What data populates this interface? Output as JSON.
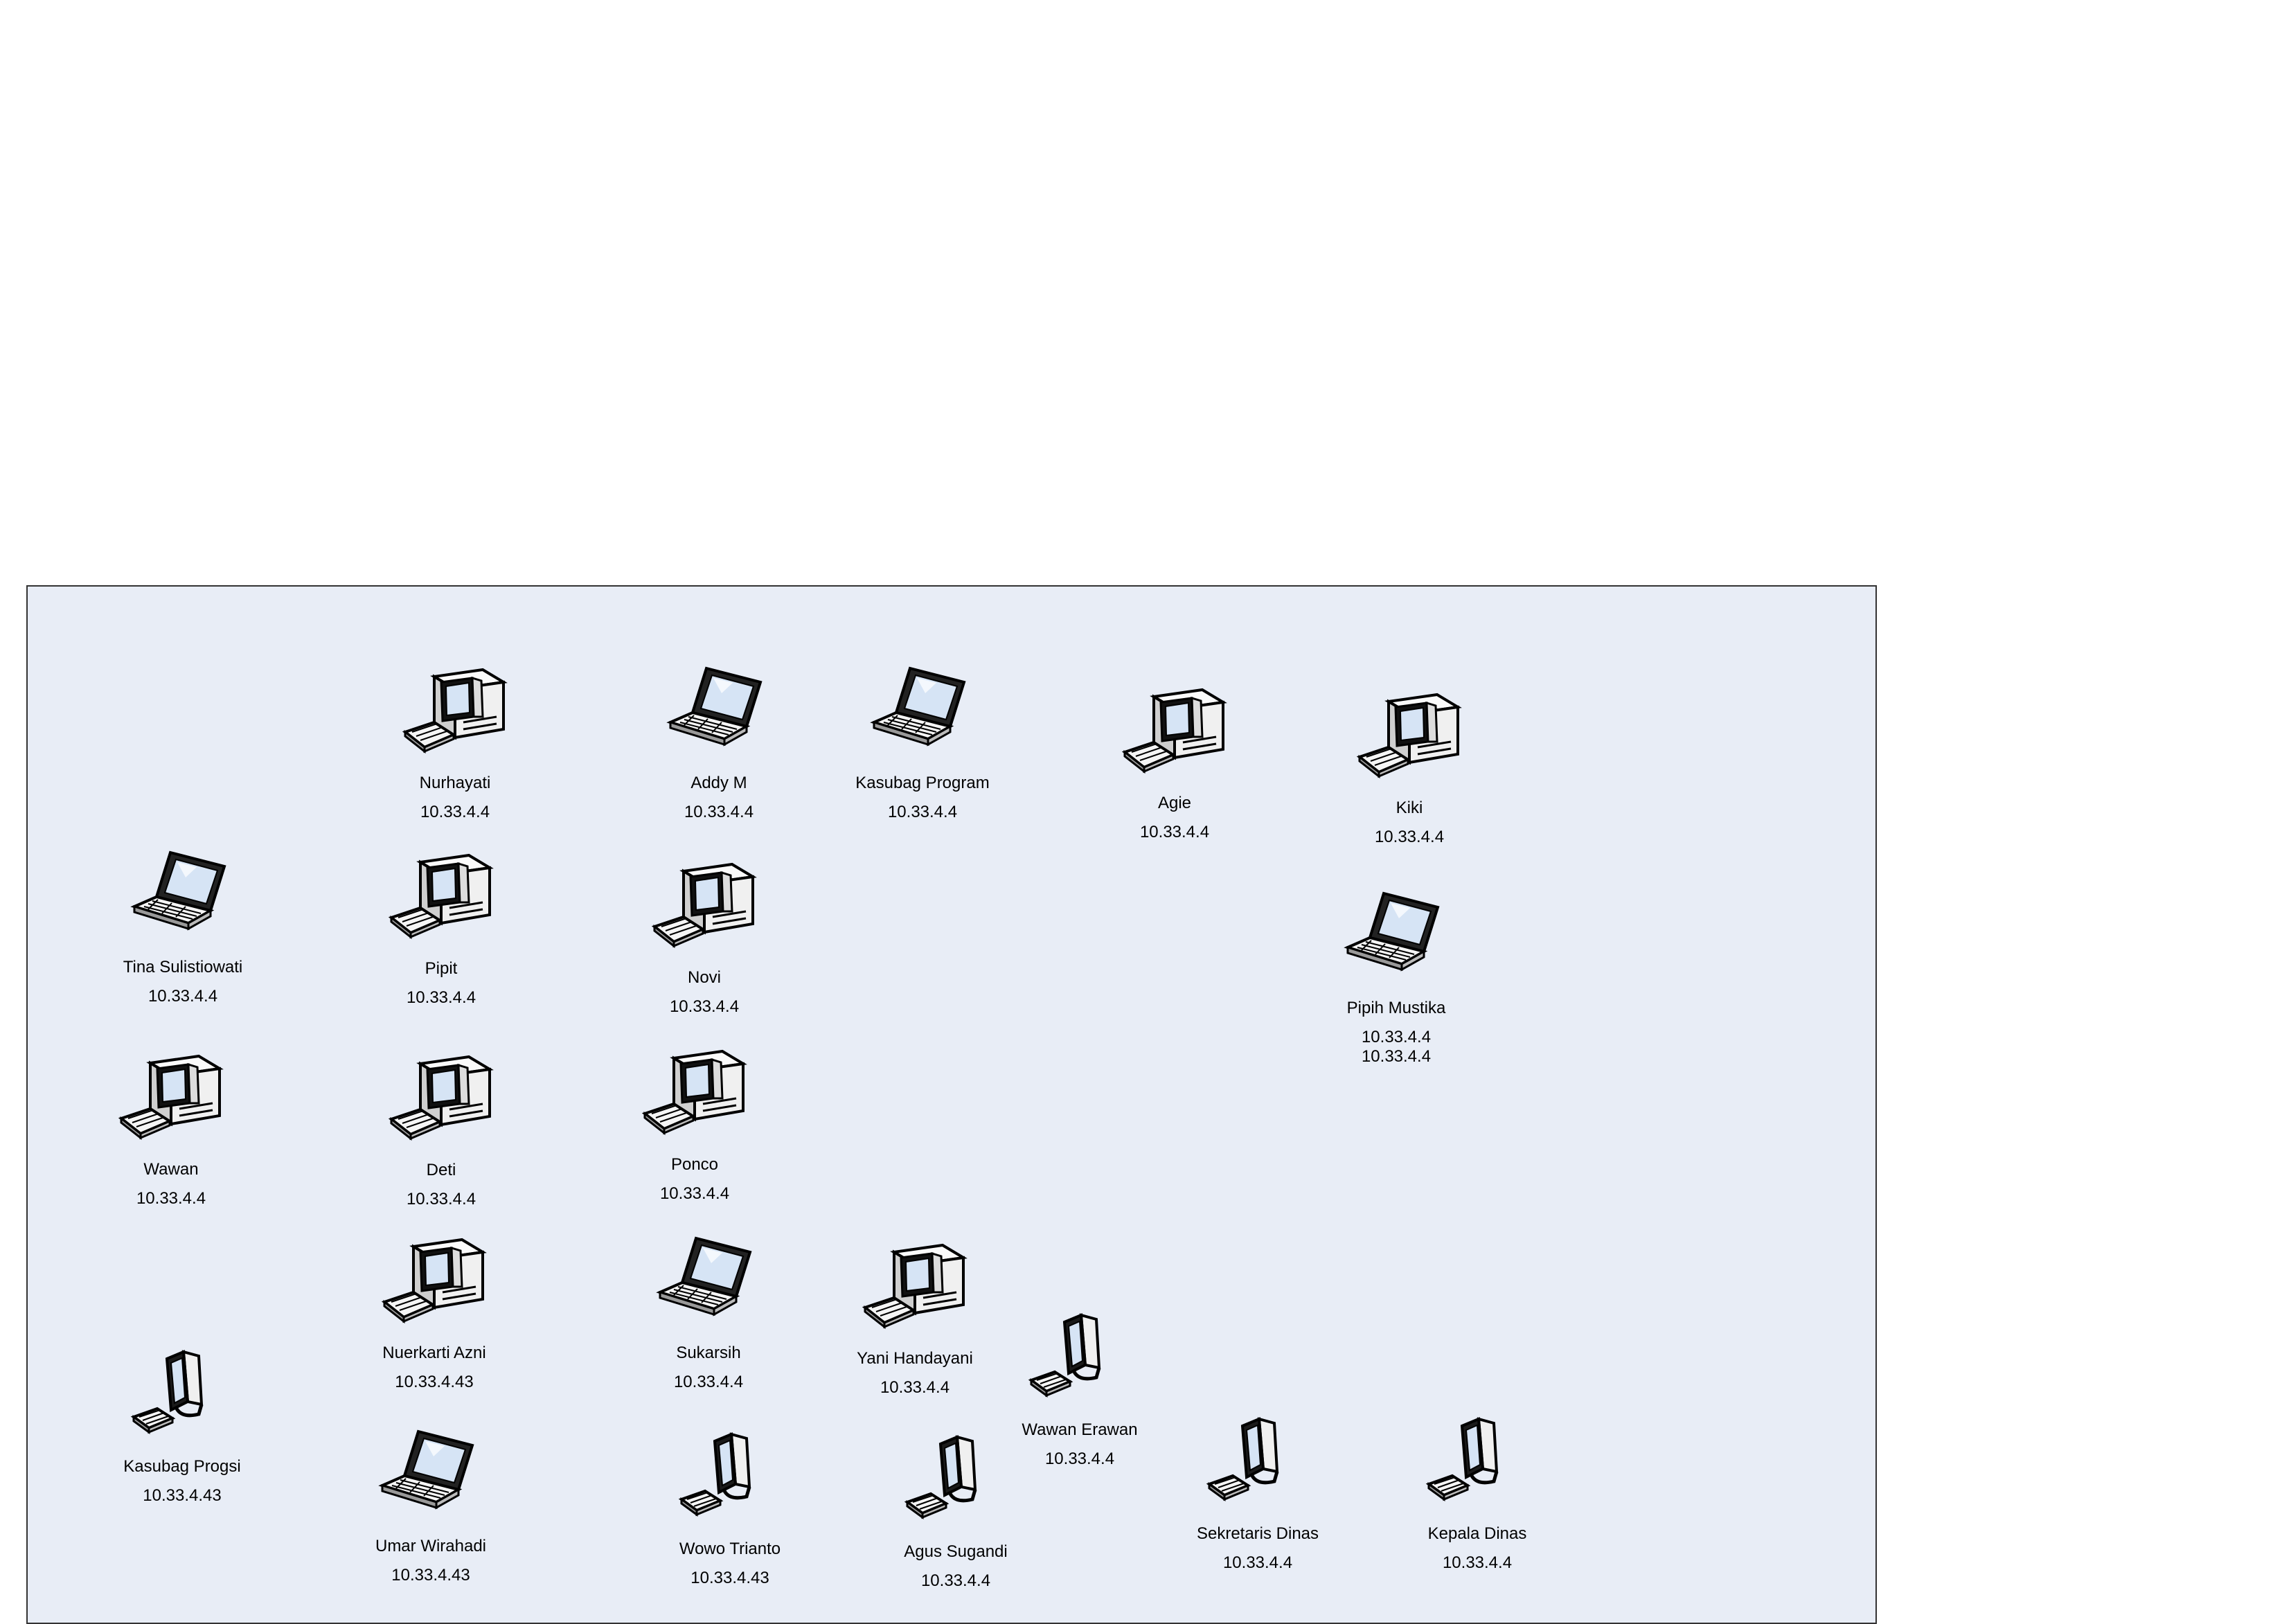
{
  "colors": {
    "background": "#ffffff",
    "diagram_area": "#e8edf6",
    "screen": "#d6e4f5"
  },
  "nodes": [
    {
      "name": "Nurhayati",
      "icon": "desktop-tower",
      "ips": [
        "10.33.4.4"
      ]
    },
    {
      "name": "Addy M",
      "icon": "laptop",
      "ips": [
        "10.33.4.4"
      ]
    },
    {
      "name": "Kasubag Program",
      "icon": "laptop",
      "ips": [
        "10.33.4.4"
      ]
    },
    {
      "name": "Agie",
      "icon": "desktop-tower",
      "ips": [
        "10.33.4.4"
      ]
    },
    {
      "name": "Kiki",
      "icon": "desktop-tower",
      "ips": [
        "10.33.4.4"
      ]
    },
    {
      "name": "Tina Sulistiowati",
      "icon": "laptop",
      "ips": [
        "10.33.4.4"
      ]
    },
    {
      "name": "Pipit",
      "icon": "desktop-tower",
      "ips": [
        "10.33.4.4"
      ]
    },
    {
      "name": "Novi",
      "icon": "desktop-tower",
      "ips": [
        "10.33.4.4"
      ]
    },
    {
      "name": "Pipih Mustika",
      "icon": "laptop",
      "ips": [
        "10.33.4.4",
        "10.33.4.4"
      ]
    },
    {
      "name": "Wawan",
      "icon": "desktop-tower",
      "ips": [
        "10.33.4.4"
      ]
    },
    {
      "name": "Deti",
      "icon": "desktop-tower",
      "ips": [
        "10.33.4.4"
      ]
    },
    {
      "name": "Ponco",
      "icon": "desktop-tower",
      "ips": [
        "10.33.4.4"
      ]
    },
    {
      "name": "Nuerkarti Azni",
      "icon": "desktop-tower",
      "ips": [
        "10.33.4.43"
      ]
    },
    {
      "name": "Sukarsih",
      "icon": "laptop",
      "ips": [
        "10.33.4.4"
      ]
    },
    {
      "name": "Yani Handayani",
      "icon": "desktop-tower",
      "ips": [
        "10.33.4.4"
      ]
    },
    {
      "name": "Wawan Erawan",
      "icon": "monitor-keyboard",
      "ips": [
        "10.33.4.4"
      ]
    },
    {
      "name": "Kasubag Progsi",
      "icon": "monitor-keyboard",
      "ips": [
        "10.33.4.43"
      ]
    },
    {
      "name": "Umar Wirahadi",
      "icon": "laptop",
      "ips": [
        "10.33.4.43"
      ]
    },
    {
      "name": "Wowo Trianto",
      "icon": "monitor-keyboard",
      "ips": [
        "10.33.4.43"
      ]
    },
    {
      "name": "Agus Sugandi",
      "icon": "monitor-keyboard",
      "ips": [
        "10.33.4.4"
      ]
    },
    {
      "name": "Sekretaris Dinas",
      "icon": "monitor-keyboard",
      "ips": [
        "10.33.4.4"
      ]
    },
    {
      "name": "Kepala Dinas",
      "icon": "monitor-keyboard",
      "ips": [
        "10.33.4.4"
      ]
    }
  ]
}
